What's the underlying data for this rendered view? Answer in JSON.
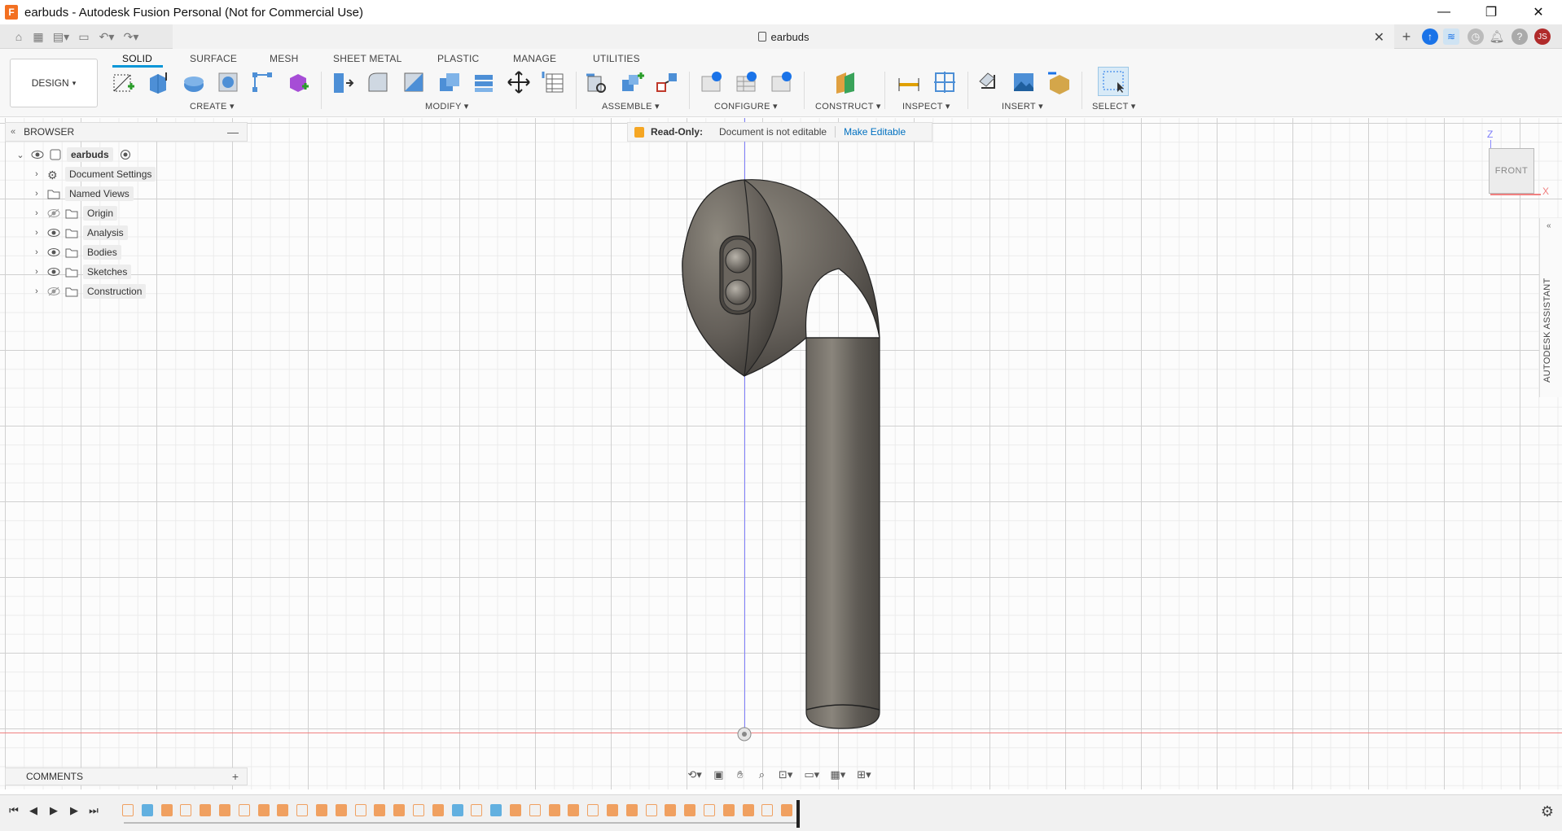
{
  "window": {
    "title": "earbuds - Autodesk Fusion Personal (Not for Commercial Use)",
    "minimize_glyph": "—",
    "restore_glyph": "❐",
    "close_glyph": "✕"
  },
  "appbar": {
    "document_tab": "earbuds",
    "close_glyph": "✕",
    "new_tab_glyph": "+",
    "user_initials": "JS"
  },
  "ribbon": {
    "workspace": "DESIGN",
    "tabs": [
      "SOLID",
      "SURFACE",
      "MESH",
      "SHEET METAL",
      "PLASTIC",
      "MANAGE",
      "UTILITIES"
    ],
    "groups": [
      "CREATE",
      "MODIFY",
      "ASSEMBLE",
      "CONFIGURE",
      "CONSTRUCT",
      "INSPECT",
      "INSERT",
      "SELECT"
    ]
  },
  "browser": {
    "title": "BROWSER",
    "root": "earbuds",
    "items": [
      "Document Settings",
      "Named Views",
      "Origin",
      "Analysis",
      "Bodies",
      "Sketches",
      "Construction"
    ]
  },
  "readonly": {
    "label": "Read-Only:",
    "message": "Document is not editable",
    "action": "Make Editable"
  },
  "viewcube": {
    "face": "FRONT",
    "axis_z": "Z",
    "axis_x": "X"
  },
  "assistant": {
    "label": "AUTODESK ASSISTANT"
  },
  "comments": {
    "title": "COMMENTS"
  },
  "colors": {
    "accent": "#0696d7",
    "timeline_feature": "#f0a060",
    "timeline_feature_alt": "#62b0e0",
    "model": "#6e6a63"
  }
}
